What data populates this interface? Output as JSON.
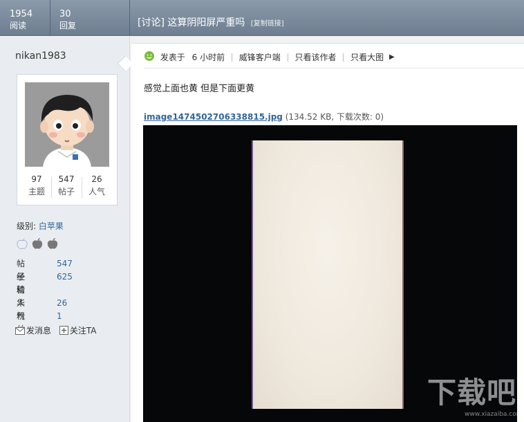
{
  "header": {
    "views": {
      "count": "1954",
      "label": "阅读"
    },
    "replies": {
      "count": "30",
      "label": "回复"
    },
    "thread_title": "[讨论] 这算阴阳屏严重吗",
    "copy_link": "[复制链接]"
  },
  "user": {
    "username": "nikan1983",
    "stats": [
      {
        "value": "97",
        "label": "主题"
      },
      {
        "value": "547",
        "label": "帖子"
      },
      {
        "value": "26",
        "label": "人气"
      }
    ],
    "level_label": "级别:",
    "level_value": "白苹果",
    "info": [
      {
        "key": "帖子",
        "value": "547"
      },
      {
        "key": "经验",
        "value": "625"
      },
      {
        "key": "精华",
        "value": ""
      },
      {
        "key": "人气",
        "value": "26"
      },
      {
        "key": "粉丝",
        "value": "1"
      }
    ],
    "actions": {
      "message": "发消息",
      "follow": "关注TA"
    }
  },
  "post": {
    "posted_prefix": "发表于",
    "posted_time": "6 小时前",
    "client": "威锋客户端",
    "author_only": "只看该作者",
    "large_image": "只看大图",
    "body": "感觉上面也黄 但是下面更黄",
    "attachment_name": "image1474502706338815.jpg",
    "attachment_info": "(134.52 KB, 下载次数: 0)"
  },
  "watermark": {
    "text": "下载吧",
    "url": "www.xiazaiba.com"
  },
  "colors": {
    "header_bar": "#7b8b9d",
    "link": "#336699",
    "sidebar": "#e9edf1"
  }
}
